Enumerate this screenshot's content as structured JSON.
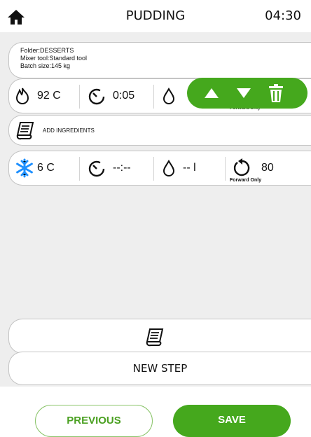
{
  "header": {
    "title": "PUDDING",
    "clock": "04:30"
  },
  "info": {
    "folder": "Folder:DESSERTS",
    "mixer": "Mixer tool:Standard tool",
    "batch": "Batch size:145 kg"
  },
  "step1": {
    "temperature": "92 C",
    "time": "0:05",
    "hidden_label": "Forward only"
  },
  "ingredients": {
    "label": "ADD INGREDIENTS"
  },
  "step2": {
    "temperature": "6 C",
    "time": "--:--",
    "water": "-- l",
    "speed": "80",
    "direction": "Forward Only"
  },
  "bottom": {
    "new_step": "NEW STEP"
  },
  "buttons": {
    "previous": "PREVIOUS",
    "save": "SAVE"
  },
  "colors": {
    "accent": "#45a81d",
    "snow": "#1e90ff"
  },
  "icons": {
    "home": "home-icon",
    "flame": "flame-icon",
    "timer": "timer-icon",
    "drop": "drop-icon",
    "up": "arrow-up-icon",
    "down": "arrow-down-icon",
    "trash": "trash-icon",
    "scroll": "scroll-icon",
    "snowflake": "snowflake-icon",
    "rotate": "rotate-icon"
  }
}
